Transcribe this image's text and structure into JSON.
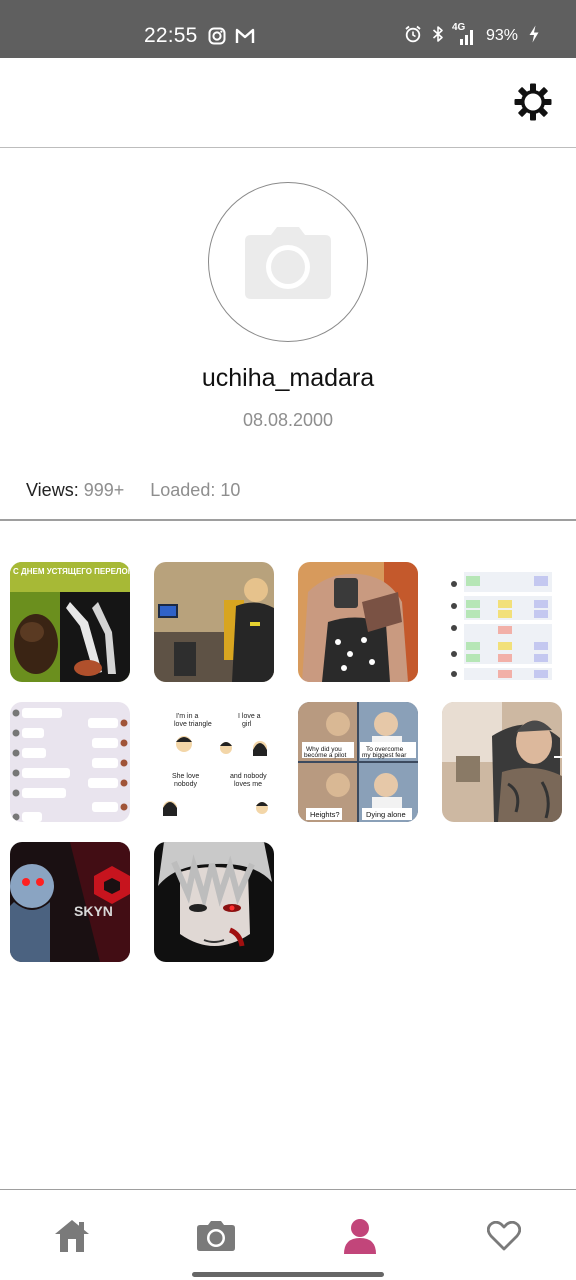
{
  "status_bar": {
    "time": "22:55",
    "network": "4G",
    "battery": "93%",
    "left_icons": [
      "instagram-icon",
      "gmail-icon"
    ],
    "right_icons": [
      "alarm-icon",
      "bluetooth-icon",
      "signal-icon",
      "charging-icon"
    ]
  },
  "top_bar": {
    "settings_icon": "gear-icon"
  },
  "profile": {
    "username": "uchiha_madara",
    "birthdate": "08.08.2000",
    "avatar_placeholder_icon": "camera-icon",
    "views_label": "Views:",
    "views_value": "999+",
    "loaded_text": "Loaded: 10"
  },
  "gallery": {
    "items": [
      {
        "image_text": "С ДНЕМ\nУСТЯЩЕГО  ПЕРЕЛОМ  ДОДЫЖЕ"
      },
      {
        "image_text": ""
      },
      {
        "image_text": ""
      },
      {
        "image_text": ""
      },
      {
        "image_text": ""
      },
      {
        "image_text": "I'm in a love triangle | I love a girl | She love nobody | and nobody loves me"
      },
      {
        "image_text": "Why did you become a pilot | To overcome my biggest fear | Heights? | Dying alone"
      },
      {
        "image_text": ""
      },
      {
        "image_text": "SKYN"
      },
      {
        "image_text": ""
      }
    ]
  },
  "bottom_nav": {
    "items": [
      {
        "name": "home",
        "icon": "home-icon",
        "active": false
      },
      {
        "name": "camera",
        "icon": "camera-icon",
        "active": false
      },
      {
        "name": "profile",
        "icon": "person-icon",
        "active": true
      },
      {
        "name": "favorites",
        "icon": "heart-icon",
        "active": false
      }
    ],
    "active_color": "#c2457a",
    "inactive_color": "#7a7a7a"
  }
}
